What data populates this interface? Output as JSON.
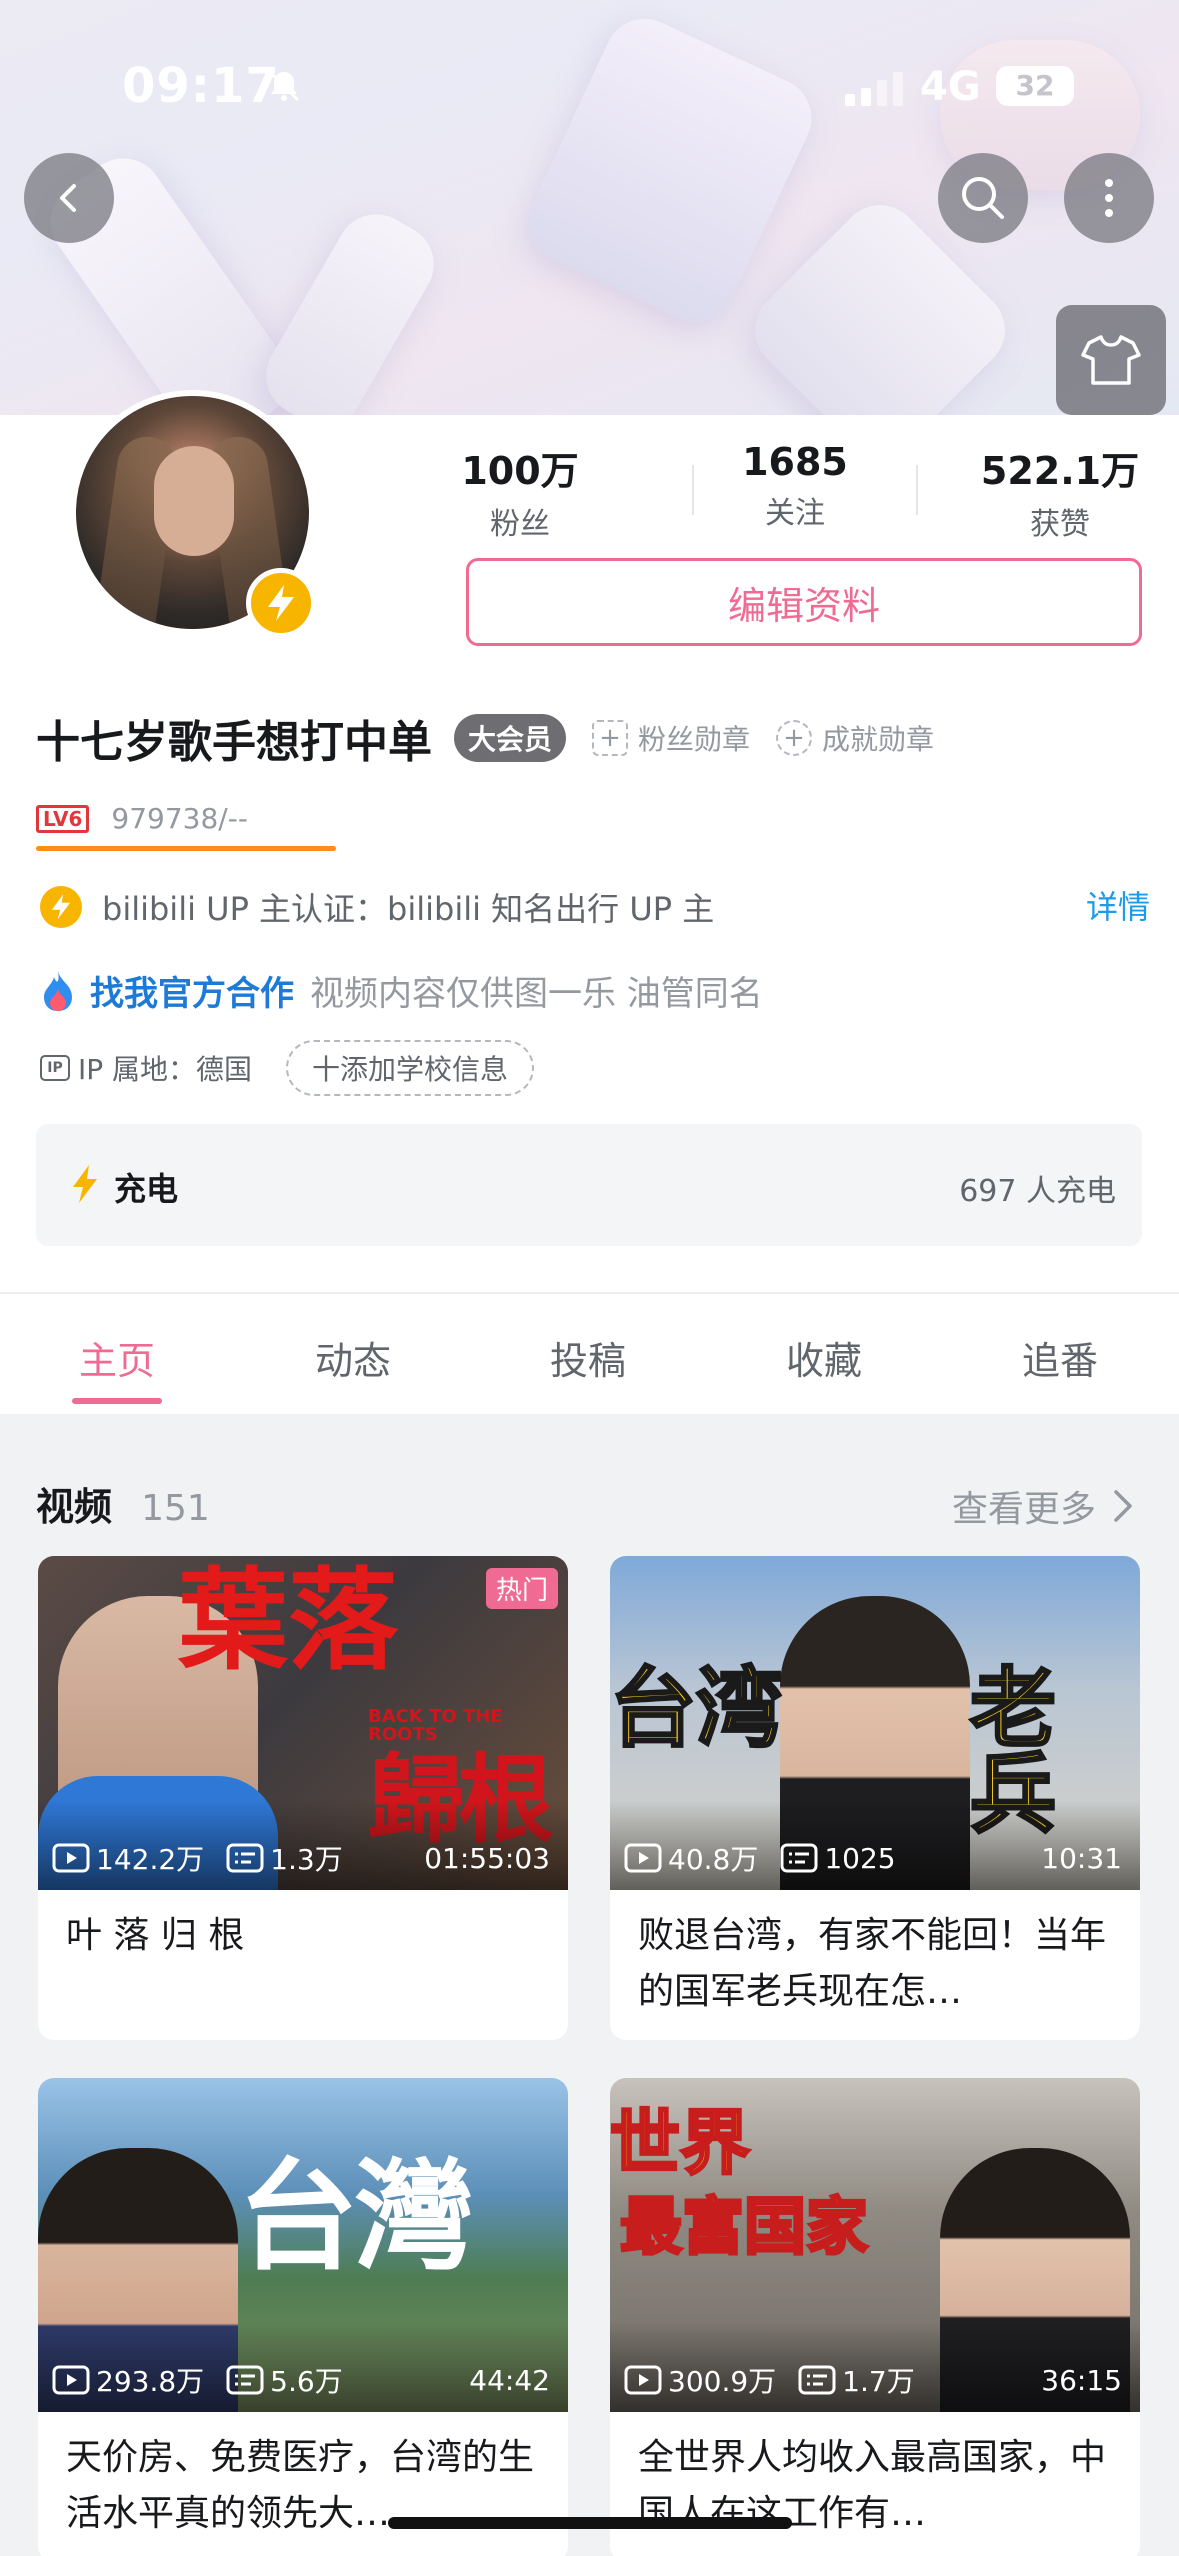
{
  "status_bar": {
    "time": "09:17",
    "network": "4G",
    "battery": "32"
  },
  "profile": {
    "stats": [
      {
        "value": "100万",
        "label": "粉丝"
      },
      {
        "value": "1685",
        "label": "关注"
      },
      {
        "value": "522.1万",
        "label": "获赞"
      }
    ],
    "edit_label": "编辑资料",
    "username": "十七岁歌手想打中单",
    "vip_label": "大会员",
    "fan_medal_label": "粉丝勋章",
    "achievement_label": "成就勋章",
    "level_badge": "LV6",
    "level_value": "979738/--",
    "certification": "bilibili UP 主认证：bilibili 知名出行 UP 主",
    "detail_label": "详情",
    "bio_link": "找我官方合作",
    "bio_text": "视频内容仅供图一乐 油管同名",
    "ip_icon": "IP",
    "ip_location": "IP 属地：德国",
    "school_label": "十添加学校信息",
    "charge_label": "充电",
    "charge_count": "697 人充电"
  },
  "tabs": [
    "主页",
    "动态",
    "投稿",
    "收藏",
    "追番"
  ],
  "videos_section": {
    "title": "视频",
    "count": "151",
    "more_label": "查看更多"
  },
  "videos": [
    {
      "title": "叶 落 归 根",
      "views": "142.2万",
      "danmaku": "1.3万",
      "duration": "01:55:03",
      "badge": "热门",
      "caption_a": "葉落",
      "caption_b": "歸根",
      "caption_small": "BACK TO THE ROOTS"
    },
    {
      "title": "败退台湾，有家不能回！当年的国军老兵现在怎…",
      "views": "40.8万",
      "danmaku": "1025",
      "duration": "10:31",
      "caption_a": "台湾",
      "caption_b": "老兵"
    },
    {
      "title": "天价房、免费医疗，台湾的生活水平真的领先大…",
      "views": "293.8万",
      "danmaku": "5.6万",
      "duration": "44:42",
      "caption_a": "台灣"
    },
    {
      "title": "全世界人均收入最高国家，中国人在这工作有…",
      "views": "300.9万",
      "danmaku": "1.7万",
      "duration": "36:15",
      "caption_a": "世界",
      "caption_b": "最富国家"
    }
  ],
  "colors": {
    "accent_pink": "#f06b93",
    "link_blue": "#1e9be8",
    "level_red": "#e1373c",
    "level_bar": "#ff8c1a",
    "vip_gold": "#f7b500"
  }
}
